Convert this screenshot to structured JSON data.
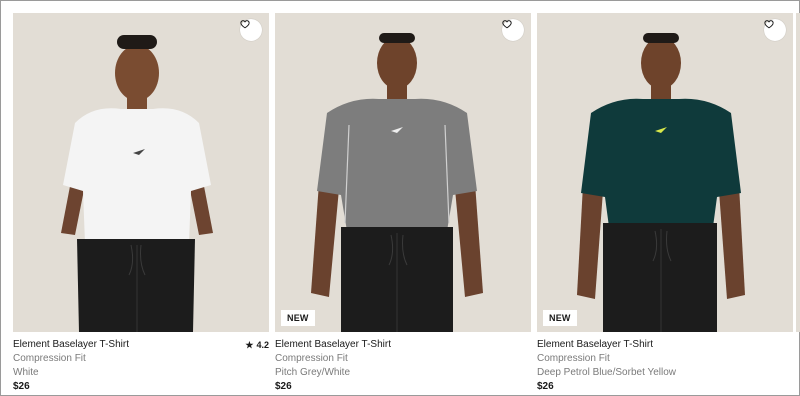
{
  "products": [
    {
      "name": "Element Baselayer T-Shirt",
      "fit": "Compression Fit",
      "color": "White",
      "price": "$26",
      "rating": "4.2",
      "badge": "",
      "shirt_color": "#f4f4f4",
      "icon": "heart-outline-icon"
    },
    {
      "name": "Element Baselayer T-Shirt",
      "fit": "Compression Fit",
      "color": "Pitch Grey/White",
      "price": "$26",
      "rating": "",
      "badge": "NEW",
      "shirt_color": "#7d7d7d",
      "icon": "heart-outline-icon"
    },
    {
      "name": "Element Baselayer T-Shirt",
      "fit": "Compression Fit",
      "color": "Deep Petrol Blue/Sorbet Yellow",
      "price": "$26",
      "rating": "",
      "badge": "NEW",
      "shirt_color": "#0f3a3b",
      "icon": "heart-outline-icon"
    }
  ],
  "colors": {
    "photo_bg": "#e2ddd5",
    "skin": "#8a5a3c",
    "pants": "#1c1c1c",
    "muted_text": "#7a7a7a"
  }
}
